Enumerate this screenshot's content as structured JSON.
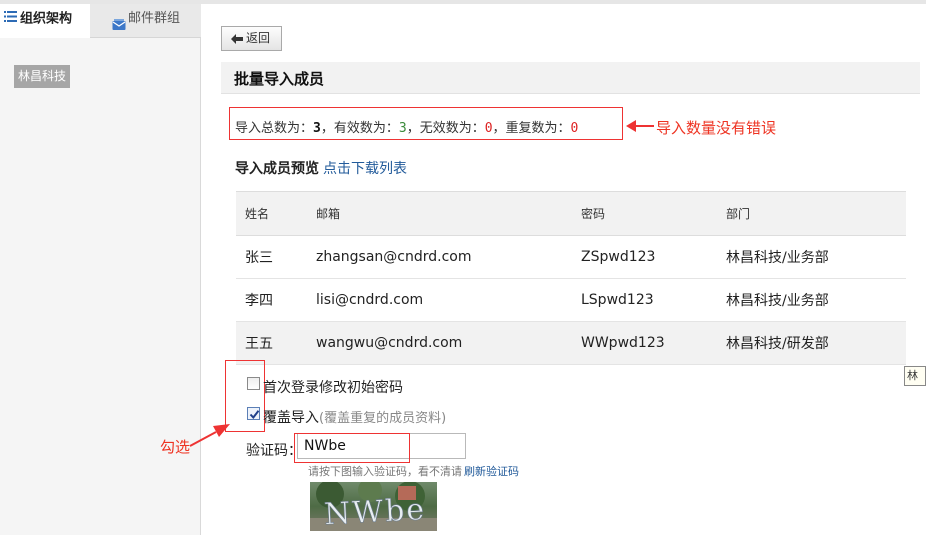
{
  "sidebar": {
    "tabs": [
      {
        "label": "组织架构",
        "icon": "list-icon",
        "active": true
      },
      {
        "label": "邮件群组",
        "icon": "mail-group-icon",
        "active": false
      }
    ],
    "selected_department": "林昌科技"
  },
  "header": {
    "back_label": "返回",
    "page_title": "批量导入成员"
  },
  "stats": {
    "total_label": "导入总数为：",
    "total": "3",
    "valid_label": "，有效数为：",
    "valid": "3",
    "invalid_label": "，无效数为：",
    "invalid": "0",
    "duplicate_label": "，重复数为：",
    "duplicate": "0"
  },
  "annotations": {
    "count_note": "导入数量没有错误",
    "check_note": "勾选"
  },
  "preview": {
    "title": "导入成员预览",
    "download_link": "点击下载列表"
  },
  "table": {
    "columns": [
      "姓名",
      "邮箱",
      "密码",
      "部门"
    ],
    "rows": [
      {
        "name": "张三",
        "email": "zhangsan@cndrd.com",
        "password": "ZSpwd123",
        "dept": "林昌科技/业务部"
      },
      {
        "name": "李四",
        "email": "lisi@cndrd.com",
        "password": "LSpwd123",
        "dept": "林昌科技/业务部"
      },
      {
        "name": "王五",
        "email": "wangwu@cndrd.com",
        "password": "WWpwd123",
        "dept": "林昌科技/研发部"
      }
    ]
  },
  "options": {
    "first_login_change": {
      "label": "首次登录修改初始密码",
      "checked": false
    },
    "overwrite_import": {
      "label": "覆盖导入",
      "hint": "(覆盖重复的成员资料)",
      "checked": true
    }
  },
  "captcha": {
    "label": "验证码：",
    "value": "NWbe",
    "help": "请按下图输入验证码，看不清请",
    "refresh_link": "刷新验证码",
    "image_text": "NWbe"
  },
  "edge_tooltip": "林",
  "colors": {
    "annotation_red": "#e33333",
    "link_blue": "#215a9a",
    "valid_green": "#3a8a3a"
  }
}
